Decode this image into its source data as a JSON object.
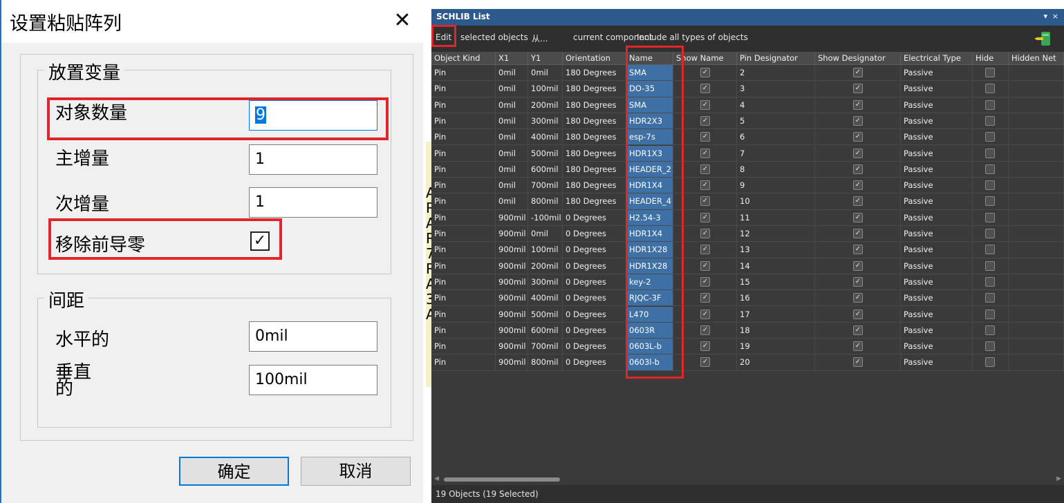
{
  "dialog": {
    "title": "设置粘贴阵列",
    "group_placement": "放置变量",
    "label_count": "对象数量",
    "value_count": "9",
    "label_primary": "主增量",
    "value_primary": "1",
    "label_secondary": "次增量",
    "value_secondary": "1",
    "label_remove_zero": "移除前导零",
    "remove_zero_checked": true,
    "checkmark": "✓",
    "group_spacing": "间距",
    "label_horizontal": "水平的",
    "value_horizontal": "0mil",
    "label_vertical_1": "垂直",
    "label_vertical_2": "的",
    "value_vertical": "100mil",
    "ok": "确定",
    "cancel": "取消",
    "close_glyph": "✕"
  },
  "margin_letters": "A\nR\nA\nR\n7\nR\nA\n3\nA",
  "panel": {
    "title": "SCHLIB List",
    "ctrl_pin": "▾",
    "ctrl_close": "×",
    "toolbar": {
      "edit": "Edit",
      "scope": "selected objects",
      "from": "从...",
      "component": "current component",
      "filter": "Include all types of objects"
    },
    "columns": [
      "Object Kind",
      "X1",
      "Y1",
      "Orientation",
      "Name",
      "Show Name",
      "Pin Designator",
      "Show Designator",
      "Electrical Type",
      "Hide",
      "Hidden Net"
    ],
    "rows": [
      {
        "kind": "Pin",
        "x1": "0mil",
        "y1": "0mil",
        "orient": "180 Degrees",
        "name": "SMA",
        "show_name": true,
        "designator": "2",
        "show_desig": true,
        "etype": "Passive",
        "hide": false
      },
      {
        "kind": "Pin",
        "x1": "0mil",
        "y1": "100mil",
        "orient": "180 Degrees",
        "name": "DO-35",
        "show_name": true,
        "designator": "3",
        "show_desig": true,
        "etype": "Passive",
        "hide": false
      },
      {
        "kind": "Pin",
        "x1": "0mil",
        "y1": "200mil",
        "orient": "180 Degrees",
        "name": "SMA",
        "show_name": true,
        "designator": "4",
        "show_desig": true,
        "etype": "Passive",
        "hide": false
      },
      {
        "kind": "Pin",
        "x1": "0mil",
        "y1": "300mil",
        "orient": "180 Degrees",
        "name": "HDR2X3",
        "show_name": true,
        "designator": "5",
        "show_desig": true,
        "etype": "Passive",
        "hide": false
      },
      {
        "kind": "Pin",
        "x1": "0mil",
        "y1": "400mil",
        "orient": "180 Degrees",
        "name": "esp-7s",
        "show_name": true,
        "designator": "6",
        "show_desig": true,
        "etype": "Passive",
        "hide": false
      },
      {
        "kind": "Pin",
        "x1": "0mil",
        "y1": "500mil",
        "orient": "180 Degrees",
        "name": "HDR1X3",
        "show_name": true,
        "designator": "7",
        "show_desig": true,
        "etype": "Passive",
        "hide": false
      },
      {
        "kind": "Pin",
        "x1": "0mil",
        "y1": "600mil",
        "orient": "180 Degrees",
        "name": "HEADER_2",
        "show_name": true,
        "designator": "8",
        "show_desig": true,
        "etype": "Passive",
        "hide": false
      },
      {
        "kind": "Pin",
        "x1": "0mil",
        "y1": "700mil",
        "orient": "180 Degrees",
        "name": "HDR1X4",
        "show_name": true,
        "designator": "9",
        "show_desig": true,
        "etype": "Passive",
        "hide": false
      },
      {
        "kind": "Pin",
        "x1": "0mil",
        "y1": "800mil",
        "orient": "180 Degrees",
        "name": "HEADER_4",
        "show_name": true,
        "designator": "10",
        "show_desig": true,
        "etype": "Passive",
        "hide": false
      },
      {
        "kind": "Pin",
        "x1": "900mil",
        "y1": "-100mil",
        "orient": "0 Degrees",
        "name": "H2.54-3",
        "show_name": true,
        "designator": "11",
        "show_desig": true,
        "etype": "Passive",
        "hide": false
      },
      {
        "kind": "Pin",
        "x1": "900mil",
        "y1": "0mil",
        "orient": "0 Degrees",
        "name": "HDR1X4",
        "show_name": true,
        "designator": "12",
        "show_desig": true,
        "etype": "Passive",
        "hide": false
      },
      {
        "kind": "Pin",
        "x1": "900mil",
        "y1": "100mil",
        "orient": "0 Degrees",
        "name": "HDR1X28",
        "show_name": true,
        "designator": "13",
        "show_desig": true,
        "etype": "Passive",
        "hide": false
      },
      {
        "kind": "Pin",
        "x1": "900mil",
        "y1": "200mil",
        "orient": "0 Degrees",
        "name": "HDR1X28",
        "show_name": true,
        "designator": "14",
        "show_desig": true,
        "etype": "Passive",
        "hide": false
      },
      {
        "kind": "Pin",
        "x1": "900mil",
        "y1": "300mil",
        "orient": "0 Degrees",
        "name": "key-2",
        "show_name": true,
        "designator": "15",
        "show_desig": true,
        "etype": "Passive",
        "hide": false
      },
      {
        "kind": "Pin",
        "x1": "900mil",
        "y1": "400mil",
        "orient": "0 Degrees",
        "name": "RJQC-3F",
        "show_name": true,
        "designator": "16",
        "show_desig": true,
        "etype": "Passive",
        "hide": false
      },
      {
        "kind": "Pin",
        "x1": "900mil",
        "y1": "500mil",
        "orient": "0 Degrees",
        "name": "L470",
        "show_name": true,
        "designator": "17",
        "show_desig": true,
        "etype": "Passive",
        "hide": false
      },
      {
        "kind": "Pin",
        "x1": "900mil",
        "y1": "600mil",
        "orient": "0 Degrees",
        "name": "0603R",
        "show_name": true,
        "designator": "18",
        "show_desig": true,
        "etype": "Passive",
        "hide": false
      },
      {
        "kind": "Pin",
        "x1": "900mil",
        "y1": "700mil",
        "orient": "0 Degrees",
        "name": "0603L-b",
        "show_name": true,
        "designator": "19",
        "show_desig": true,
        "etype": "Passive",
        "hide": false
      },
      {
        "kind": "Pin",
        "x1": "900mil",
        "y1": "800mil",
        "orient": "0 Degrees",
        "name": "0603l-b",
        "show_name": true,
        "designator": "20",
        "show_desig": true,
        "etype": "Passive",
        "hide": false
      }
    ],
    "status": "19 Objects (19 Selected)",
    "scroll_left": "◀",
    "scroll_right": "▶",
    "colors": {
      "title_bar": "#2d5a8c",
      "selected_column": "#3e6fa5",
      "highlight_red": "#e0252b",
      "background": "#3a3a3a"
    }
  }
}
